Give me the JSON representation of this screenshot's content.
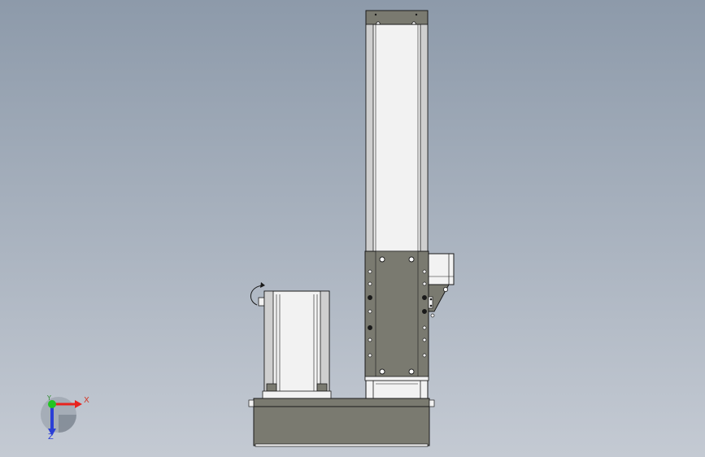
{
  "viewport": {
    "background_top": "#8d9aaa",
    "background_bottom": "#c4cad3"
  },
  "model": {
    "edge_color": "#1a1a1a",
    "dark_plate_color": "#7a7a70",
    "light_tube_color": "#f2f2f2",
    "tube_shade_color": "#cfcfcf"
  },
  "triad": {
    "x_label": "X",
    "y_label": "Y",
    "z_label": "Z",
    "x_color": "#e8231e",
    "y_color": "#22c422",
    "z_color": "#2b3fd6",
    "x_label_color": "#d23a2a",
    "y_label_color": "#2e8b2e",
    "z_label_color": "#2b3fd6"
  }
}
